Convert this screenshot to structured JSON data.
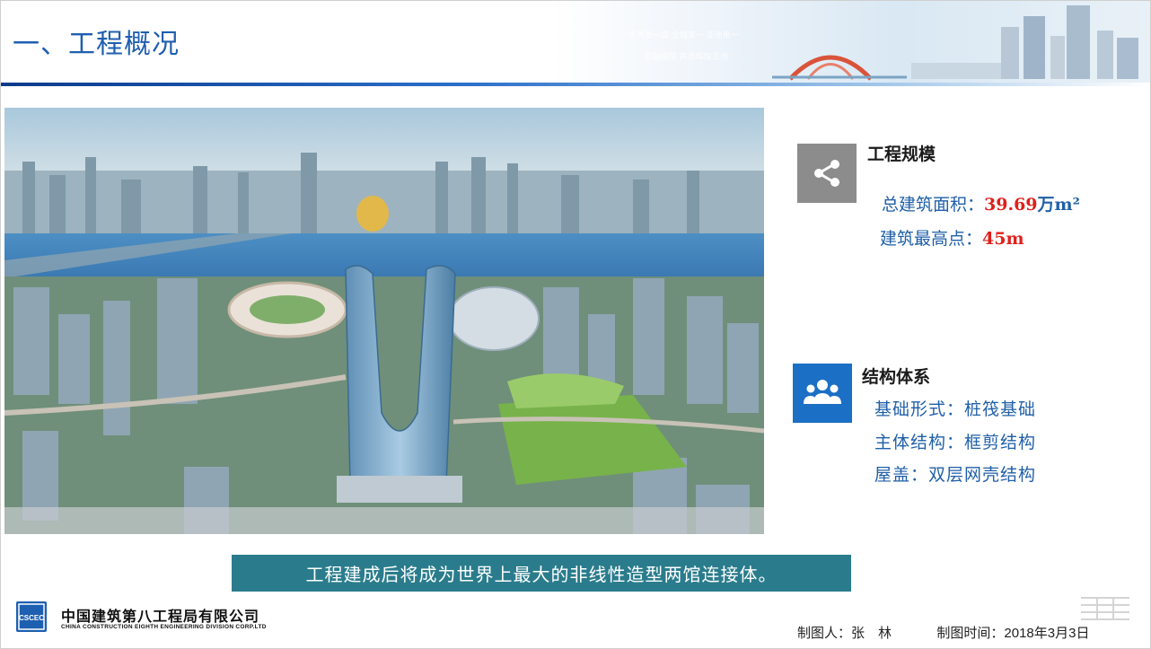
{
  "header": {
    "title": "一、工程概况",
    "slogan_line1": "世界第一高 全城第一 亚洲第一",
    "slogan_line2": "超越极限 再造辉煌五洲"
  },
  "main_image": {
    "alt": "project rendering aerial city view"
  },
  "scale": {
    "title": "工程规模",
    "area_label": "总建筑面积：",
    "area_value": "39.69",
    "area_unit": "万m²",
    "height_label": "建筑最高点：",
    "height_value": "45m",
    "icon": "share-icon"
  },
  "structure": {
    "title": "结构体系",
    "icon": "team-icon",
    "rows": [
      "基础形式：桩筏基础",
      "主体结构：框剪结构",
      "屋盖：双层网壳结构"
    ]
  },
  "caption": "工程建成后将成为世界上最大的非线性造型两馆连接体。",
  "footer": {
    "logo_text": "CSCEC",
    "company_cn": "中国建筑第八工程局有限公司",
    "company_en": "CHINA CONSTRUCTION EIGHTH ENGINEERING DIVISION CORP.LTD",
    "author_label": "制图人：",
    "author": "张　林",
    "time_label": "制图时间：",
    "time": "2018年3月3日"
  },
  "colors": {
    "title_blue": "#1f5fb0",
    "value_red": "#e0201c",
    "caption_bg": "#2a7c8c",
    "icon_grey": "#8c8c8c",
    "icon_blue": "#1b6fc4"
  }
}
